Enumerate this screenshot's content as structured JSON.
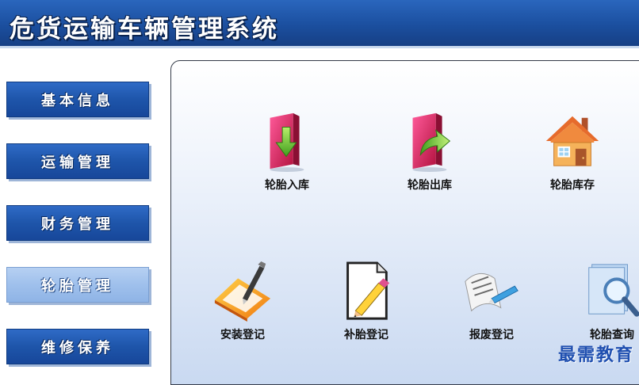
{
  "header": {
    "title": "危货运输车辆管理系统"
  },
  "sidebar": {
    "items": [
      {
        "label": "基本信息"
      },
      {
        "label": "运输管理"
      },
      {
        "label": "财务管理"
      },
      {
        "label": "轮胎管理"
      },
      {
        "label": "维修保养"
      }
    ],
    "active": "轮胎管理"
  },
  "main": {
    "tiles": [
      {
        "label": "轮胎入库",
        "icon": "folder-in-icon"
      },
      {
        "label": "轮胎出库",
        "icon": "folder-out-icon"
      },
      {
        "label": "轮胎库存",
        "icon": "house-icon"
      },
      {
        "label": "安装登记",
        "icon": "folder-pen-icon"
      },
      {
        "label": "补胎登记",
        "icon": "document-pencil-icon"
      },
      {
        "label": "报废登记",
        "icon": "paper-pen-icon"
      },
      {
        "label": "轮胎查询",
        "icon": "magnifier-icon"
      }
    ]
  },
  "watermark": {
    "text": "最需教育"
  }
}
